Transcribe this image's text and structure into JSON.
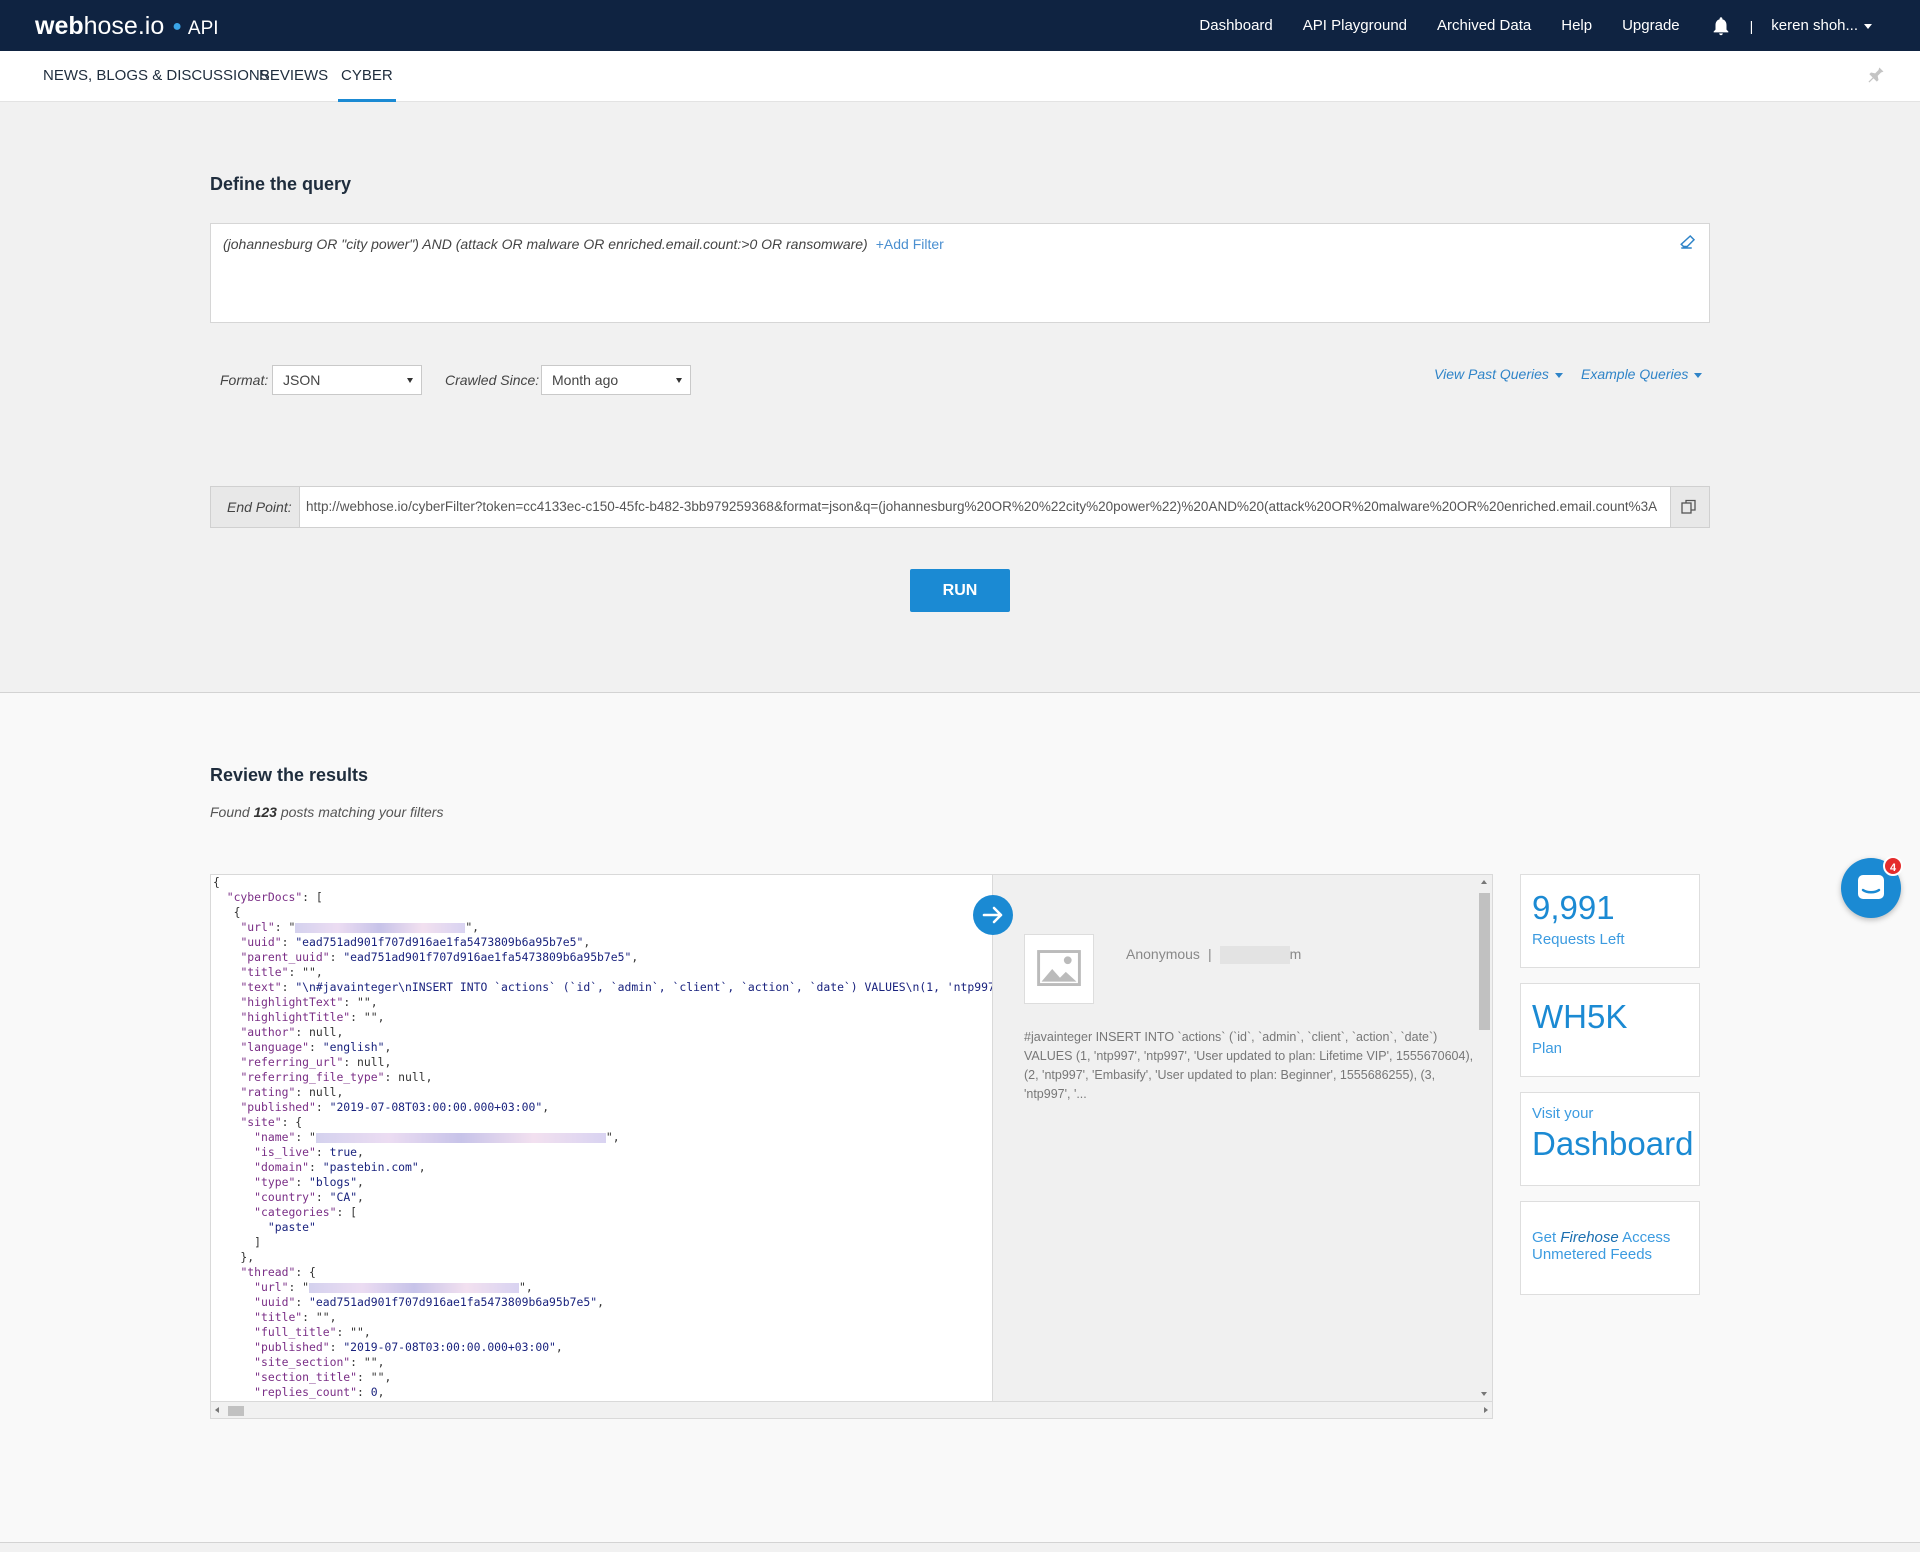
{
  "brand": {
    "logo_bold": "web",
    "logo_rest": "hose.io",
    "product": "API"
  },
  "topnav": {
    "items": [
      "Dashboard",
      "API Playground",
      "Archived Data",
      "Help",
      "Upgrade"
    ],
    "separator": "|",
    "user": "keren shoh..."
  },
  "tabs": [
    "NEWS, BLOGS & DISCUSSIONS",
    "REVIEWS",
    "CYBER"
  ],
  "active_tab": "CYBER",
  "query": {
    "heading": "Define the query",
    "text": "(johannesburg OR \"city power\") AND (attack OR malware OR enriched.email.count:>0 OR ransomware)",
    "add_filter": "+Add Filter",
    "format_label": "Format:",
    "format_value": "JSON",
    "crawled_label": "Crawled Since:",
    "crawled_value": "Month ago",
    "view_past": "View Past Queries",
    "examples": "Example Queries",
    "endpoint_label": "End Point:",
    "endpoint_url": "http://webhose.io/cyberFilter?token=cc4133ec-c150-45fc-b482-3bb979259368&format=json&q=(johannesburg%20OR%20%22city%20power%22)%20AND%20(attack%20OR%20malware%20OR%20enriched.email.count%3A",
    "run": "RUN"
  },
  "results": {
    "heading": "Review the results",
    "found_prefix": "Found",
    "found_count": "123",
    "found_suffix": "posts matching your filters",
    "json": {
      "root_key": "cyberDocs",
      "uuid": "ead751ad901f707d916ae1fa5473809b6a95b7e5",
      "parent_uuid": "ead751ad901f707d916ae1fa5473809b6a95b7e5",
      "text": "\\n#javainteger\\nINSERT INTO `actions` (`id`, `admin`, `client`, `action`, `date`) VALUES\\n(1, 'ntp997', 'ntp997', 'User updated to plan: Lifetime VIP', 1555670604",
      "language": "english",
      "published": "2019-07-08T03:00:00.000+03:00",
      "domain": "pastebin.com",
      "type": "blogs",
      "country": "CA",
      "category": "paste",
      "thread_uuid": "ead751ad901f707d916ae1fa5473809b6a95b7e5",
      "thread_published": "2019-07-08T03:00:00.000+03:00",
      "replies_count": "0"
    },
    "preview": {
      "author": "Anonymous",
      "separator": "|",
      "author_tail": "m",
      "text": "#javainteger INSERT INTO `actions` (`id`, `admin`, `client`, `action`, `date`) VALUES (1, 'ntp997', 'ntp997', 'User updated to plan: Lifetime VIP', 1555670604), (2, 'ntp997', 'Embasify', 'User updated to plan: Beginner', 1555686255), (3, 'ntp997', '..."
    }
  },
  "sidebar_cards": {
    "requests_value": "9,991",
    "requests_label": "Requests Left",
    "plan_value": "WH5K",
    "plan_label": "Plan",
    "visit_small": "Visit your",
    "visit_big": "Dashboard",
    "firehose_pre": "Get",
    "firehose_em": "Firehose",
    "firehose_post": "Access",
    "firehose_line2": "Unmetered Feeds"
  },
  "chat": {
    "badge": "4"
  },
  "colors": {
    "navbar": "#0f2341",
    "accent": "#1b8ad3",
    "link": "#2f84c8"
  },
  "icons": [
    "bell-icon",
    "pin-icon",
    "eraser-icon",
    "copy-icon",
    "arrow-right-icon",
    "image-placeholder-icon",
    "chat-icon"
  ]
}
